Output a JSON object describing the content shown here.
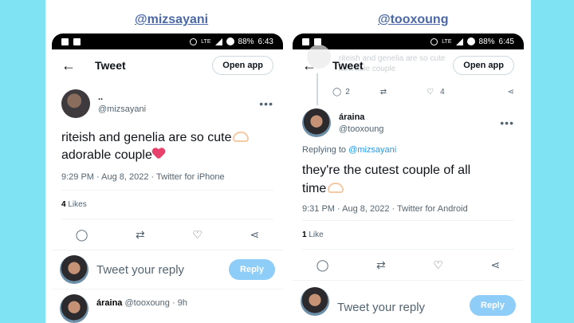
{
  "left": {
    "handle": "@mizsayani",
    "status": {
      "battery": "88%",
      "time": "6:43",
      "net": "LTE"
    },
    "topbar": {
      "title": "Tweet",
      "open_app": "Open app"
    },
    "tweet": {
      "display_name": "..",
      "username": "@mizsayani",
      "text_line1": "riteish and genelia are so cute",
      "text_line2": "adorable couple",
      "meta": "9:29 PM · Aug 8, 2022 · Twitter for iPhone",
      "likes_count": "4",
      "likes_label": "Likes"
    },
    "reply_box": {
      "placeholder": "Tweet your reply",
      "button": "Reply"
    },
    "next_reply": {
      "name": "áraina",
      "username": "@tooxoung",
      "age": "· 9h"
    }
  },
  "right": {
    "handle": "@tooxoung",
    "status": {
      "battery": "88%",
      "time": "6:45",
      "net": "LTE"
    },
    "topbar": {
      "title": "Tweet",
      "open_app": "Open app"
    },
    "faded_text": {
      "line1": "riteish and genelia are so cute",
      "line2": "adorable couple"
    },
    "parent_actions": {
      "replies": "2",
      "likes": "4"
    },
    "tweet": {
      "display_name": "áraina",
      "username": "@tooxoung",
      "replying_to_label": "Replying to",
      "replying_to_user": "@mizsayani",
      "text_line1": "they're the cutest couple of all",
      "text_line2": "time",
      "meta": "9:31 PM · Aug 8, 2022 · Twitter for Android",
      "likes_count": "1",
      "likes_label": "Like"
    },
    "reply_box": {
      "placeholder": "Tweet your reply",
      "button": "Reply"
    }
  },
  "colors": {
    "background": "#7fe3f4",
    "handle": "#4a68a5",
    "link": "#1d9bf0",
    "reply_button": "#8ecdf7"
  }
}
